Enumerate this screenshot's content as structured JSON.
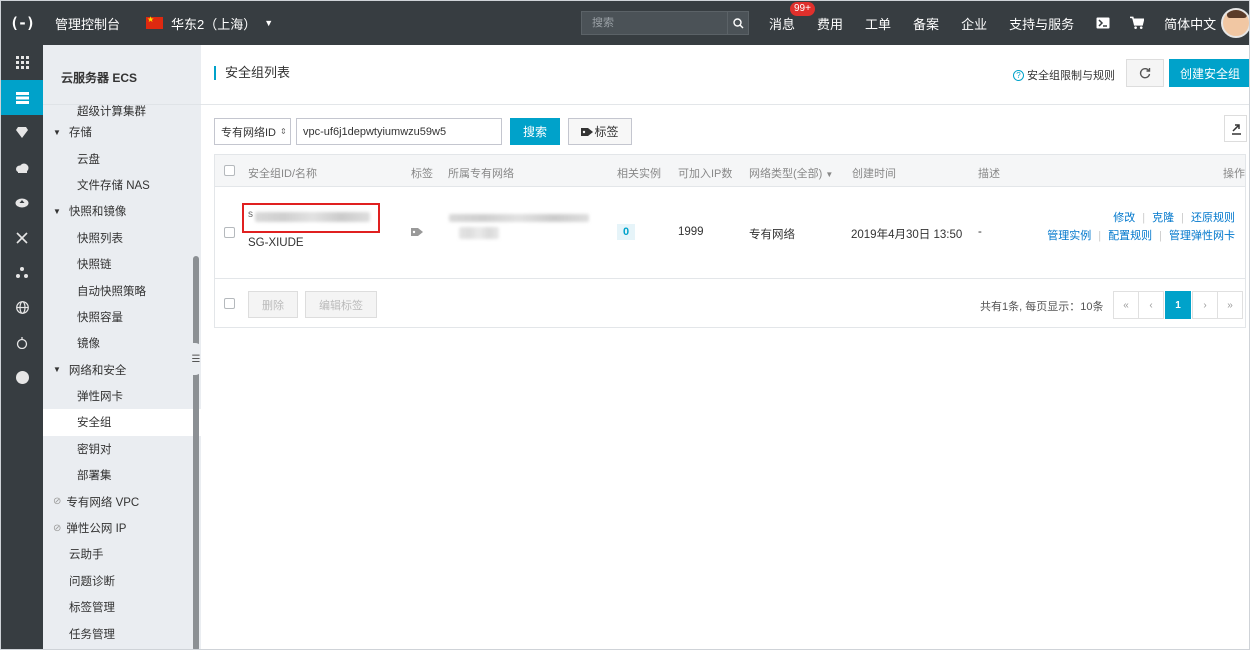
{
  "topbar": {
    "logo": "(-)",
    "console_title": "管理控制台",
    "region": "华东2（上海）",
    "search_placeholder": "搜索",
    "message_badge": "99+",
    "nav": [
      "消息",
      "费用",
      "工单",
      "备案",
      "企业",
      "支持与服务"
    ],
    "language": "简体中文"
  },
  "rail_icons": [
    "apps-grid-icon",
    "server-list-icon",
    "diamond-icon",
    "cloud-icon",
    "cloud-upload-icon",
    "shuffle-icon",
    "nodes-icon",
    "globe-icon",
    "database-icon",
    "circle-icon"
  ],
  "sidebar": {
    "title": "云服务器 ECS",
    "items": [
      {
        "label": "超级计算集群",
        "level": "l2",
        "type": "cut"
      },
      {
        "label": "存储",
        "level": "l1",
        "type": "group"
      },
      {
        "label": "云盘",
        "level": "l2"
      },
      {
        "label": "文件存储 NAS",
        "level": "l2"
      },
      {
        "label": "快照和镜像",
        "level": "l1",
        "type": "group"
      },
      {
        "label": "快照列表",
        "level": "l2"
      },
      {
        "label": "快照链",
        "level": "l2"
      },
      {
        "label": "自动快照策略",
        "level": "l2"
      },
      {
        "label": "快照容量",
        "level": "l2"
      },
      {
        "label": "镜像",
        "level": "l2"
      },
      {
        "label": "网络和安全",
        "level": "l1",
        "type": "group"
      },
      {
        "label": "弹性网卡",
        "level": "l2"
      },
      {
        "label": "安全组",
        "level": "l2",
        "type": "active"
      },
      {
        "label": "密钥对",
        "level": "l2"
      },
      {
        "label": "部署集",
        "level": "l2"
      },
      {
        "label": "专有网络 VPC",
        "level": "l1",
        "type": "link"
      },
      {
        "label": "弹性公网 IP",
        "level": "l1",
        "type": "link"
      },
      {
        "label": "云助手",
        "level": "l1"
      },
      {
        "label": "问题诊断",
        "level": "l1"
      },
      {
        "label": "标签管理",
        "level": "l1"
      },
      {
        "label": "任务管理",
        "level": "l1"
      }
    ]
  },
  "header": {
    "title": "安全组列表",
    "limit_link": "安全组限制与规则",
    "create_button": "创建安全组"
  },
  "filter": {
    "select_value": "专有网络ID",
    "input_value": "vpc-uf6j1depwtyiumwzu59w5",
    "search_button": "搜索",
    "tag_button": "标签"
  },
  "table": {
    "columns": {
      "id_name": "安全组ID/名称",
      "tags": "标签",
      "vpc": "所属专有网络",
      "instances": "相关实例",
      "ips": "可加入IP数",
      "network_type": "网络类型(全部)",
      "created": "创建时间",
      "desc": "描述",
      "ops": "操作"
    },
    "rows": [
      {
        "id_prefix": "s",
        "name": "SG-XIUDE",
        "instances": "0",
        "ips": "1999",
        "network_type": "专有网络",
        "created": "2019年4月30日 13:50",
        "desc": "-",
        "ops_line1": [
          "修改",
          "克隆",
          "还原规则"
        ],
        "ops_line2": [
          "管理实例",
          "配置规则",
          "管理弹性网卡"
        ]
      }
    ],
    "footer": {
      "delete_button": "删除",
      "edit_tags_button": "编辑标签",
      "total_text": "共有1条, 每页显示：10条",
      "pager": [
        "«",
        "‹",
        "1",
        "›",
        "»"
      ]
    }
  },
  "colors": {
    "accent": "#00a2ca",
    "topbar": "#373d41",
    "highlight": "#e02020"
  }
}
